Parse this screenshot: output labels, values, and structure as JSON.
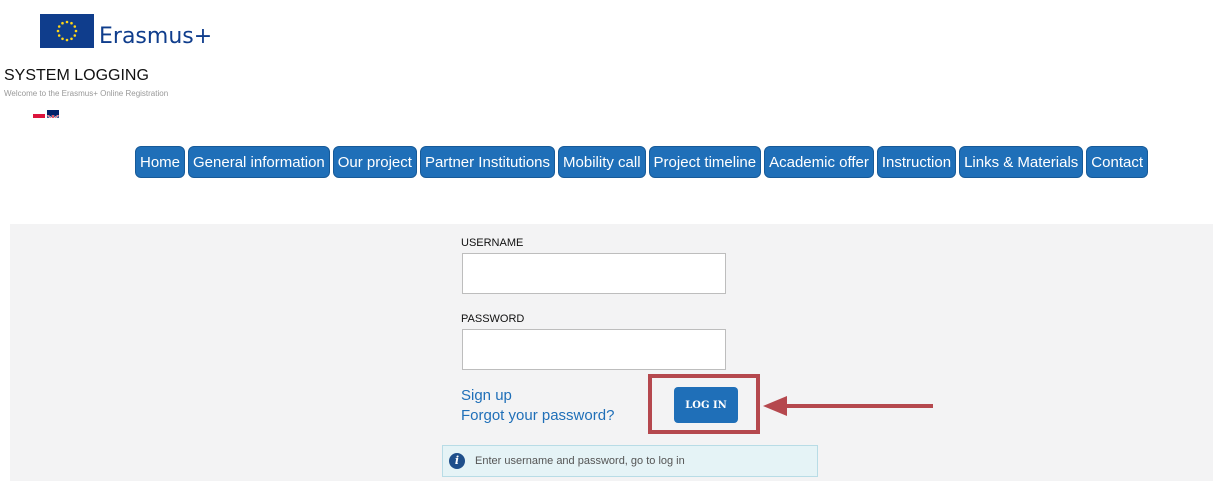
{
  "header": {
    "brand": "Erasmus+",
    "system_title": "SYSTEM LOGGING",
    "welcome": "Welcome to the Erasmus+ Online Registration"
  },
  "nav": {
    "items": [
      {
        "label": "Home"
      },
      {
        "label": "General information"
      },
      {
        "label": "Our project"
      },
      {
        "label": "Partner Institutions"
      },
      {
        "label": "Mobility call"
      },
      {
        "label": "Project timeline"
      },
      {
        "label": "Academic offer"
      },
      {
        "label": "Instruction"
      },
      {
        "label": "Links & Materials"
      },
      {
        "label": "Contact"
      }
    ]
  },
  "login": {
    "username_label": "USERNAME",
    "password_label": "PASSWORD",
    "username_value": "",
    "password_value": "",
    "signup": "Sign up",
    "forgot": "Forgot your password?",
    "button": "LOG IN",
    "info": "Enter username and password, go to log in"
  },
  "colors": {
    "accent": "#1f6fb8",
    "brand": "#0f3d8c",
    "highlight": "#b5484e",
    "panel": "#f3f3f4",
    "info_bg": "#e5f3f6"
  },
  "icons": {
    "flag": "eu-flag-icon",
    "languages": [
      "polish-flag-icon",
      "uk-flag-icon"
    ],
    "info": "info-icon",
    "annotation": "arrow-left-icon"
  }
}
